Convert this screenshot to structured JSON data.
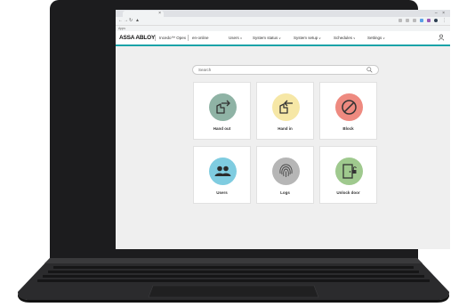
{
  "browser": {
    "bookmarks_label": "Apps"
  },
  "header": {
    "brand": "ASSA ABLOY",
    "product": "Incedo™ Opex",
    "instance": "en-online",
    "menu": [
      {
        "label": "Users",
        "chevron": "chevron-down-icon"
      },
      {
        "label": "System status",
        "chevron": "chevron-down-icon"
      },
      {
        "label": "System setup",
        "chevron": "chevron-down-icon"
      },
      {
        "label": "Schedules",
        "chevron": "chevron-down-icon"
      },
      {
        "label": "Settings",
        "chevron": "chevron-down-icon"
      }
    ],
    "accent_color": "#1aa3a8"
  },
  "search": {
    "placeholder": "Search",
    "icon": "search-icon"
  },
  "tiles": [
    {
      "label": "Hand out",
      "icon": "hand-out-icon",
      "color": "#8fb3a5"
    },
    {
      "label": "Hand in",
      "icon": "hand-in-icon",
      "color": "#f6e7a6"
    },
    {
      "label": "Block",
      "icon": "block-icon",
      "color": "#ee8a80"
    },
    {
      "label": "Users",
      "icon": "users-icon",
      "color": "#7fcce0"
    },
    {
      "label": "Logs",
      "icon": "fingerprint-icon",
      "color": "#b6b6b6"
    },
    {
      "label": "Unlock door",
      "icon": "unlock-door-icon",
      "color": "#9fc98e"
    }
  ]
}
